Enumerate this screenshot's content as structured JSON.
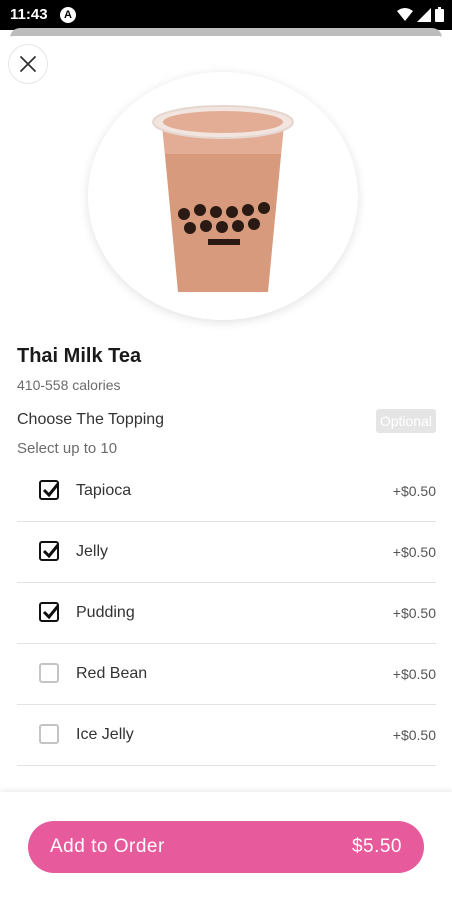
{
  "status": {
    "time": "11:43",
    "notification_letter": "A"
  },
  "product": {
    "name": "Thai Milk Tea",
    "calories": "410-558 calories",
    "image_icon": "milk-tea-cup"
  },
  "options": {
    "title": "Choose The Topping",
    "subtitle": "Select up to 10",
    "badge": "Optional",
    "items": [
      {
        "label": "Tapioca",
        "price": "+$0.50",
        "checked": true
      },
      {
        "label": "Jelly",
        "price": "+$0.50",
        "checked": true
      },
      {
        "label": "Pudding",
        "price": "+$0.50",
        "checked": true
      },
      {
        "label": "Red Bean",
        "price": "+$0.50",
        "checked": false
      },
      {
        "label": "Ice Jelly",
        "price": "+$0.50",
        "checked": false
      }
    ]
  },
  "footer": {
    "add_label": "Add to Order",
    "total": "$5.50"
  },
  "colors": {
    "accent": "#e75a9b",
    "status_bar": "#000000"
  }
}
